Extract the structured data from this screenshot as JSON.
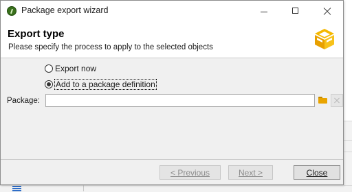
{
  "window": {
    "title": "Package export wizard"
  },
  "header": {
    "title": "Export type",
    "description": "Please specify the process to apply to the selected objects",
    "icon": "package-box-icon",
    "accent": "#f5b800"
  },
  "options": {
    "export_now_label": "Export now",
    "add_to_package_label": "Add to a package definition",
    "selected": "add_to_package"
  },
  "package": {
    "label": "Package:",
    "value": ""
  },
  "footer": {
    "previous_label": "< Previous",
    "next_label": "Next >",
    "close_label": "Close"
  }
}
